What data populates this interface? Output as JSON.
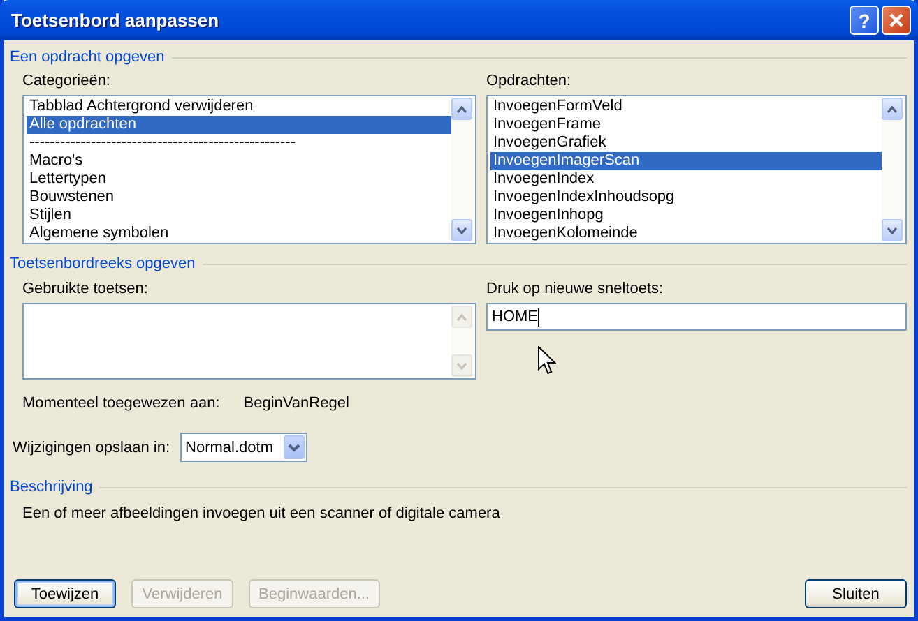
{
  "window": {
    "title": "Toetsenbord aanpassen",
    "help_button": "?"
  },
  "command_section": {
    "title": "Een opdracht opgeven",
    "categories": {
      "label": "Categorieën:",
      "items": [
        {
          "text": "Tabblad Achtergrond verwijderen",
          "selected": false
        },
        {
          "text": "Alle opdrachten",
          "selected": true
        },
        {
          "text": "----------------------------------------------------",
          "selected": false
        },
        {
          "text": "Macro's",
          "selected": false
        },
        {
          "text": "Lettertypen",
          "selected": false
        },
        {
          "text": "Bouwstenen",
          "selected": false
        },
        {
          "text": "Stijlen",
          "selected": false
        },
        {
          "text": "Algemene symbolen",
          "selected": false
        }
      ]
    },
    "commands": {
      "label": "Opdrachten:",
      "items": [
        {
          "text": "InvoegenFormVeld",
          "selected": false
        },
        {
          "text": "InvoegenFrame",
          "selected": false
        },
        {
          "text": "InvoegenGrafiek",
          "selected": false
        },
        {
          "text": "InvoegenImagerScan",
          "selected": true
        },
        {
          "text": "InvoegenIndex",
          "selected": false
        },
        {
          "text": "InvoegenIndexInhoudsopg",
          "selected": false
        },
        {
          "text": "InvoegenInhopg",
          "selected": false
        },
        {
          "text": "InvoegenKolomeinde",
          "selected": false
        }
      ]
    }
  },
  "key_section": {
    "title": "Toetsenbordreeks opgeven",
    "current_keys": {
      "label": "Gebruikte toetsen:"
    },
    "new_key": {
      "label": "Druk op nieuwe sneltoets:",
      "value": "HOME"
    },
    "assigned": {
      "label": "Momenteel toegewezen aan:",
      "value": "BeginVanRegel"
    },
    "save_in": {
      "label": "Wijzigingen opslaan in:",
      "value": "Normal.dotm"
    }
  },
  "description": {
    "title": "Beschrijving",
    "text": "Een of meer afbeeldingen invoegen uit een scanner of digitale camera"
  },
  "buttons": [
    {
      "label": "Toewijzen",
      "disabled": false,
      "default": true
    },
    {
      "label": "Verwijderen",
      "disabled": true,
      "default": false
    },
    {
      "label": "Beginwaarden...",
      "disabled": true,
      "default": false
    },
    {
      "label": "Sluiten",
      "disabled": false,
      "default": false
    }
  ]
}
